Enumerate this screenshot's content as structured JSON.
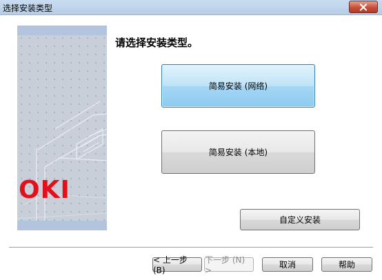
{
  "window": {
    "title": "选择安装类型",
    "close_icon": "close-icon"
  },
  "side_panel": {
    "logo_text": "OKI",
    "accent_color": "#e3101c"
  },
  "main": {
    "heading": "请选择安装类型。",
    "options": [
      {
        "label": "简易安装 (网络)",
        "state": "focused"
      },
      {
        "label": "简易安装 (本地)",
        "state": "normal"
      }
    ],
    "custom_install_label": "自定义安装"
  },
  "footer": {
    "back_label": "< 上一步 (B)",
    "next_label": "下一步 (N) >",
    "cancel_label": "取消",
    "help_label": "帮助"
  }
}
